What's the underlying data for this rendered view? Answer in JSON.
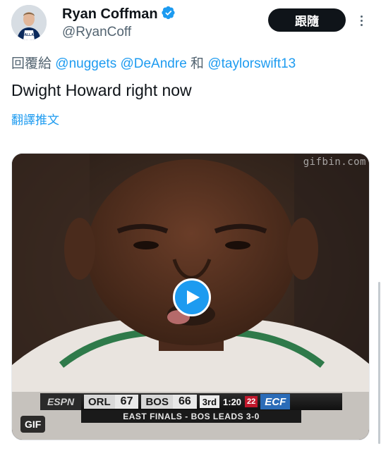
{
  "author": {
    "display_name": "Ryan Coffman",
    "handle": "@RyanCoff",
    "verified": true
  },
  "follow_button_label": "跟隨",
  "reply_context": {
    "prefix": "回覆給",
    "mentions": [
      "@nuggets",
      "@DeAndre",
      "@taylorswift13"
    ],
    "conjunction": "和"
  },
  "tweet_text": "Dwight Howard right now",
  "translate_label": "翻譯推文",
  "media": {
    "type": "GIF",
    "badge_label": "GIF",
    "watermark": "gifbin.com",
    "scorebug": {
      "network": "ESPN",
      "away_team": "ORL",
      "away_score": "67",
      "home_team": "BOS",
      "home_score": "66",
      "period": "3rd",
      "clock": "1:20",
      "shot_clock": "22",
      "series_logo": "ECF",
      "caption": "EAST FINALS - BOS LEADS 3-0"
    }
  },
  "colors": {
    "accent": "#1d9bf0",
    "text": "#0f1419",
    "secondary_text": "#536471",
    "button_bg": "#0f1419"
  },
  "icons": {
    "verified": "verified-badge-icon",
    "more": "more-dots-icon",
    "play": "play-icon"
  }
}
